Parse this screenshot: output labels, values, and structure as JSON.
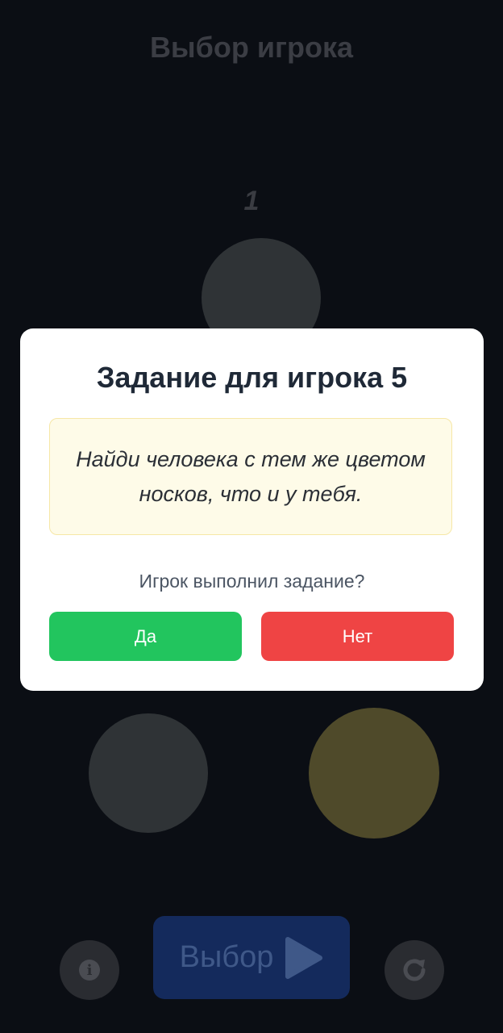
{
  "screen": {
    "title": "Выбор игрока",
    "current_player_number": "1"
  },
  "players": [
    {
      "id": "top",
      "color": "#2f3336"
    },
    {
      "id": "bottom-left",
      "color": "#2f3336"
    },
    {
      "id": "bottom-right",
      "color": "#4f4a2a"
    }
  ],
  "bottom_bar": {
    "choose_label": "Выбор",
    "info_icon": "info-icon",
    "choose_icon": "play-icon",
    "reset_icon": "refresh-icon"
  },
  "modal": {
    "title": "Задание для игрока 5",
    "task": "Найди человека с тем же цветом носков, что и у тебя.",
    "question": "Игрок выполнил задание?",
    "yes_label": "Да",
    "no_label": "Нет"
  },
  "colors": {
    "background": "#0b0e14",
    "yes": "#22c55e",
    "no": "#ef4444",
    "task_box": "#fefbe8",
    "choose_button": "#142a5c"
  }
}
